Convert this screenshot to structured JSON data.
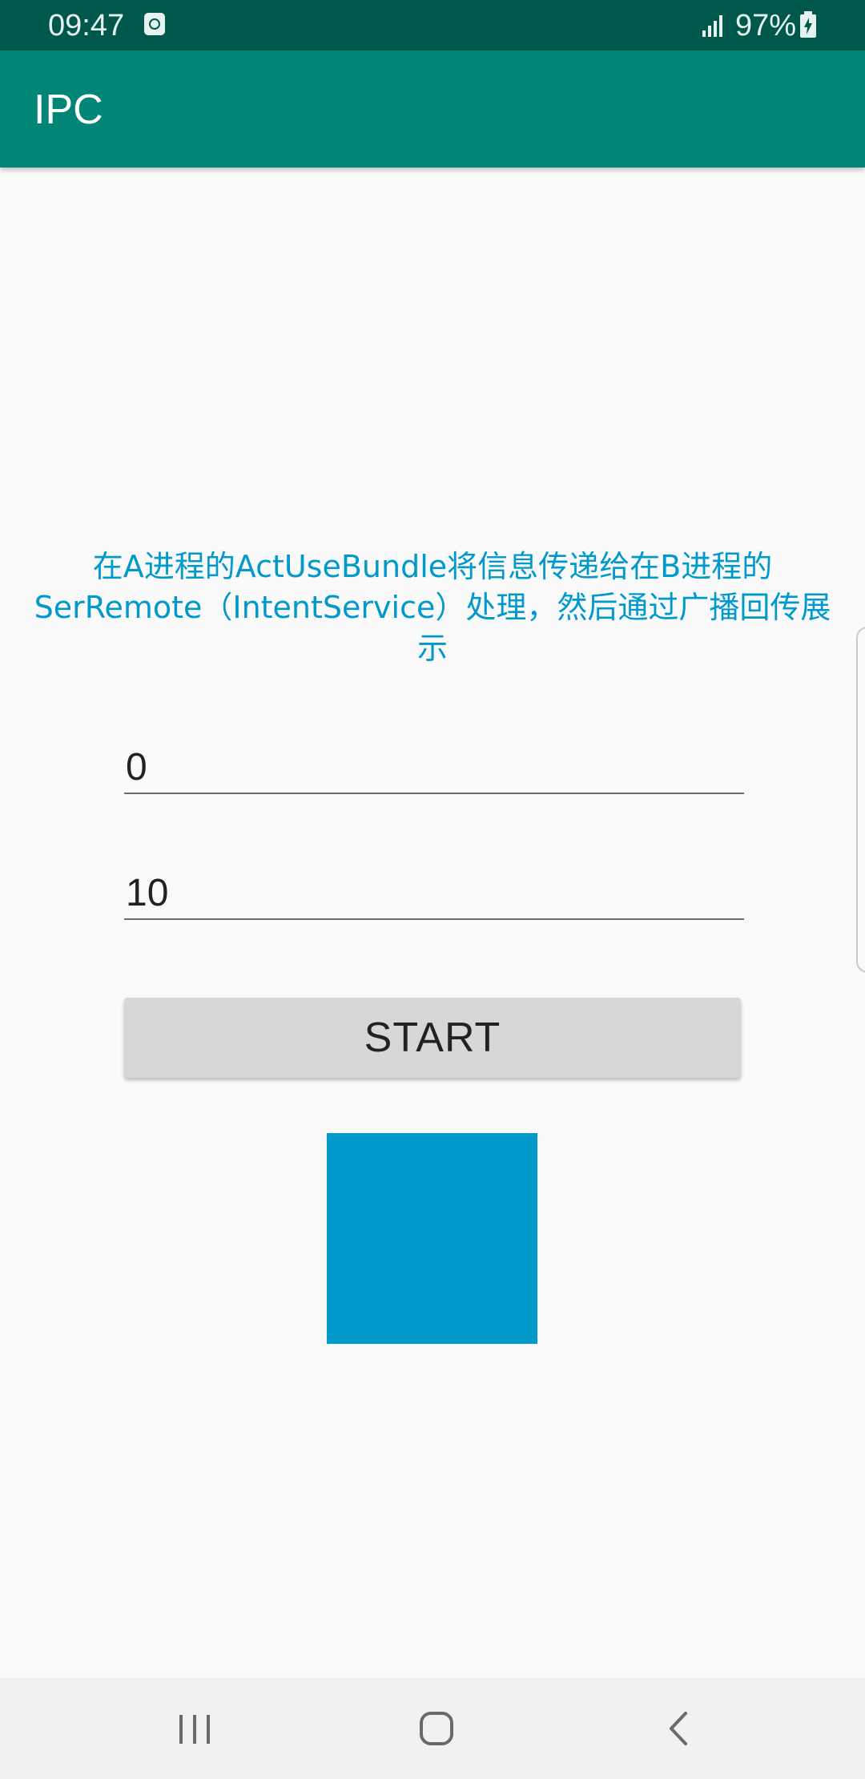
{
  "status_bar": {
    "time": "09:47",
    "battery": "97%",
    "icons": [
      "clock-notification-icon",
      "signal-icon",
      "battery-charging-icon"
    ]
  },
  "app_bar": {
    "title": "IPC"
  },
  "main": {
    "description": "在A进程的ActUseBundle将信息传递给在B进程的SerRemote（IntentService）处理，然后通过广播回传展示",
    "input_first": {
      "value": "0"
    },
    "input_second": {
      "value": "10"
    },
    "start_button_label": "START",
    "square_color": "#0099cc"
  },
  "nav_bar": {
    "buttons": [
      "recent-apps",
      "home",
      "back"
    ]
  },
  "colors": {
    "status_bar": "#00584d",
    "app_bar": "#008577",
    "accent_text": "#0099cc",
    "background": "#fafafa",
    "button": "#d6d7d7"
  }
}
